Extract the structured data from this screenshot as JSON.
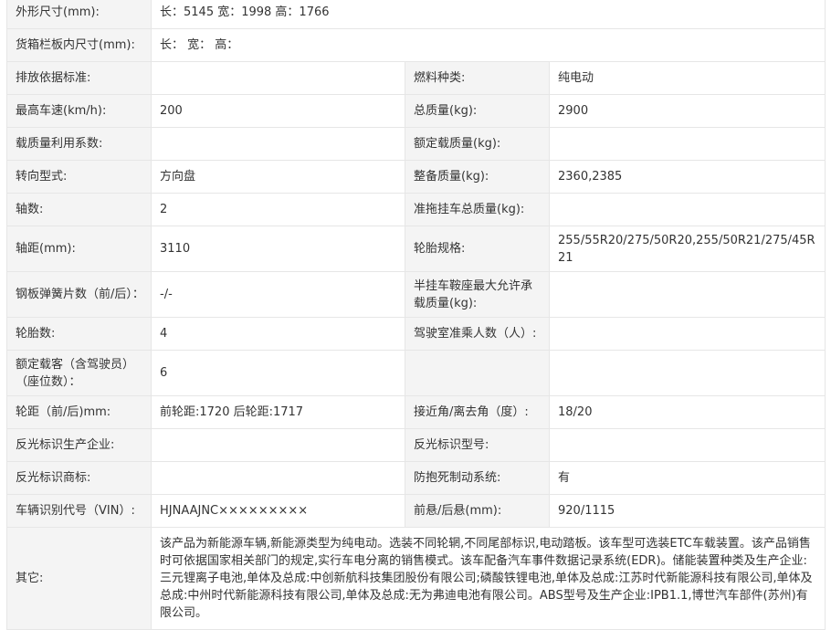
{
  "rows": [
    {
      "k1": "外形尺寸(mm):",
      "v1": "长：5145 宽：1998 高：1766",
      "full": true
    },
    {
      "k1": "货箱栏板内尺寸(mm):",
      "v1": "长： 宽： 高：",
      "full": true
    },
    {
      "k1": "排放依据标准:",
      "v1": "",
      "k2": "燃料种类:",
      "v2": "纯电动"
    },
    {
      "k1": "最高车速(km/h):",
      "v1": "200",
      "k2": "总质量(kg):",
      "v2": "2900"
    },
    {
      "k1": "载质量利用系数:",
      "v1": "",
      "k2": "额定载质量(kg):",
      "v2": ""
    },
    {
      "k1": "转向型式:",
      "v1": "方向盘",
      "k2": "整备质量(kg):",
      "v2": "2360,2385"
    },
    {
      "k1": "轴数:",
      "v1": "2",
      "k2": "准拖挂车总质量(kg):",
      "v2": ""
    },
    {
      "k1": "轴距(mm):",
      "v1": "3110",
      "k2": "轮胎规格:",
      "v2": "255/55R20/275/50R20,255/50R21/275/45R21"
    },
    {
      "k1": "钢板弹簧片数（前/后）：",
      "v1": "-/-",
      "k2": "半挂车鞍座最大允许承载质量(kg):",
      "v2": ""
    },
    {
      "k1": "轮胎数:",
      "v1": "4",
      "k2": "驾驶室准乘人数（人）:",
      "v2": ""
    },
    {
      "k1": "额定载客（含驾驶员）（座位数）：",
      "v1": "6",
      "k2": "",
      "v2": ""
    },
    {
      "k1": "轮距（前/后)mm:",
      "v1": "前轮距:1720 后轮距:1717",
      "k2": "接近角/离去角（度）:",
      "v2": "18/20"
    },
    {
      "k1": "反光标识生产企业:",
      "v1": "",
      "k2": "反光标识型号:",
      "v2": ""
    },
    {
      "k1": "反光标识商标:",
      "v1": "",
      "k2": "防抱死制动系统:",
      "v2": "有"
    },
    {
      "k1": "车辆识别代号（VIN）:",
      "v1": "HJNAAJNC×××××××××",
      "k2": "前悬/后悬(mm):",
      "v2": "920/1115"
    },
    {
      "k1": "其它:",
      "v1": "该产品为新能源车辆,新能源类型为纯电动。选装不同轮辋,不同尾部标识,电动踏板。该车型可选装ETC车载装置。该产品销售时可依据国家相关部门的规定,实行车电分离的销售模式。该车配备汽车事件数据记录系统(EDR)。储能装置种类及生产企业:三元锂离子电池,单体及总成:中创新航科技集团股份有限公司;磷酸铁锂电池,单体及总成:江苏时代新能源科技有限公司,单体及总成:中州时代新能源科技有限公司,单体及总成:无为弗迪电池有限公司。ABS型号及生产企业:IPB1.1,博世汽车部件(苏州)有限公司。",
      "full": true
    }
  ]
}
